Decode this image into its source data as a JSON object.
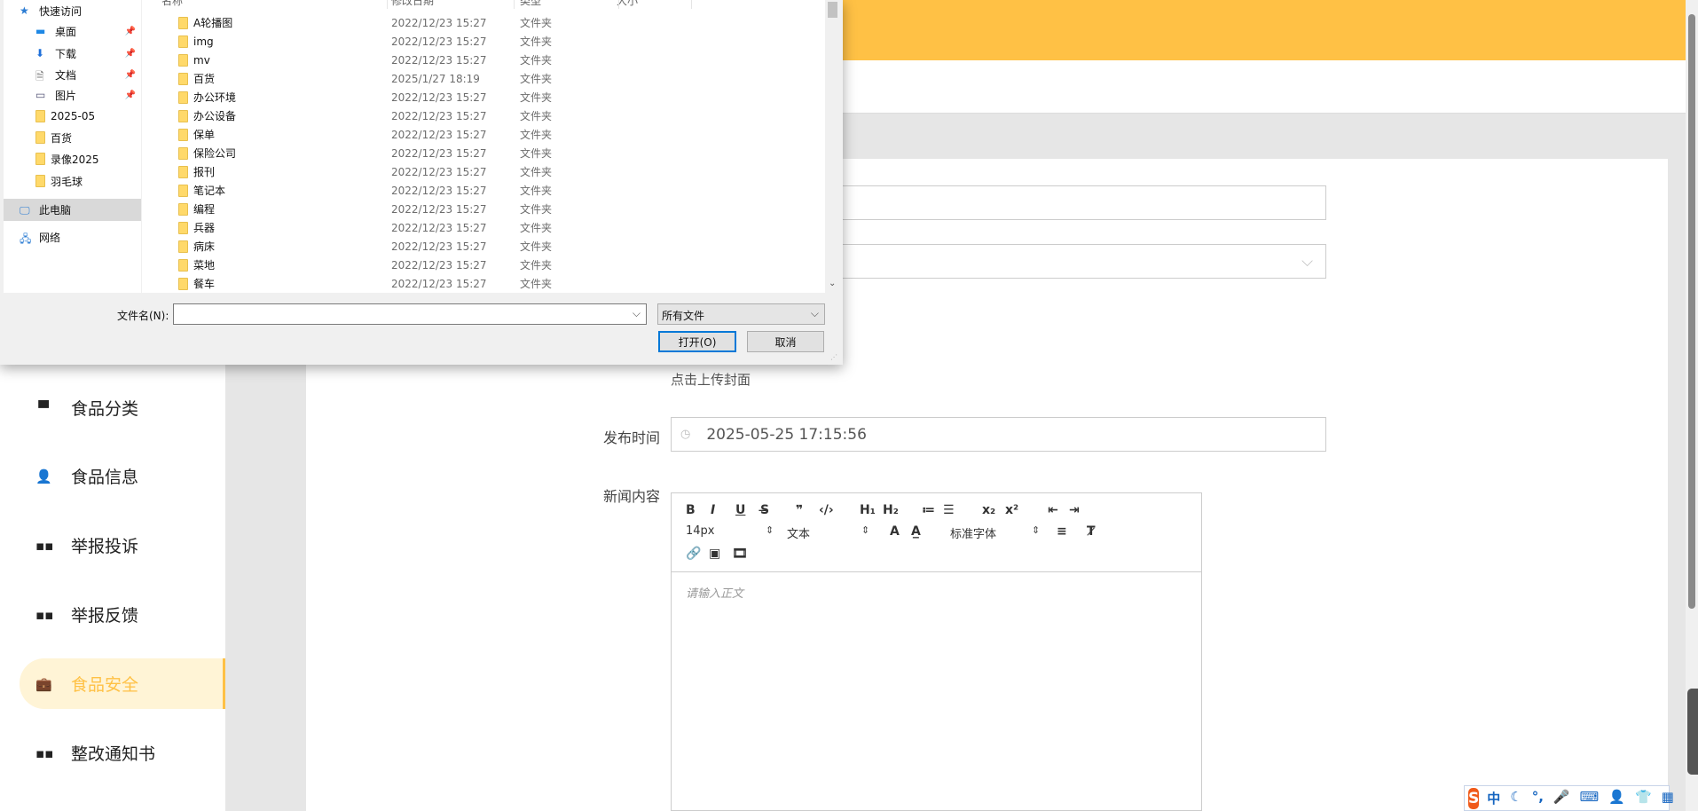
{
  "sidebar": {
    "items": [
      {
        "label": "食品分类",
        "icon": "shop-icon",
        "glyph": "▀"
      },
      {
        "label": "食品信息",
        "icon": "user-icon",
        "glyph": "👤"
      },
      {
        "label": "举报投诉",
        "icon": "grid-icon",
        "glyph": "▪▪"
      },
      {
        "label": "举报反馈",
        "icon": "grid-icon",
        "glyph": "▪▪"
      },
      {
        "label": "食品安全",
        "icon": "briefcase-icon",
        "glyph": "💼",
        "active": true
      },
      {
        "label": "整改通知书",
        "icon": "grid-icon",
        "glyph": "▪▪"
      }
    ]
  },
  "form": {
    "upload_cover": "点击上传封面",
    "publish_time_label": "发布时间",
    "publish_time_value": "2025-05-25 17:15:56",
    "content_label": "新闻内容",
    "content_placeholder": "请输入正文"
  },
  "editor": {
    "font_size": "14px",
    "header_select": "文本",
    "font_family": "标准字体",
    "buttons": [
      "bold",
      "italic",
      "underline",
      "strike",
      "blockquote",
      "code-block",
      "h1",
      "h2",
      "ordered-list",
      "bullet-list",
      "subscript",
      "superscript",
      "outdent",
      "indent",
      "font-color",
      "background",
      "align",
      "clean",
      "link",
      "image",
      "video"
    ]
  },
  "dialog": {
    "columns": [
      "名称",
      "修改日期",
      "类型",
      "大小"
    ],
    "nav": [
      {
        "label": "快速访问",
        "icon": "star-icon"
      },
      {
        "label": "桌面",
        "icon": "desktop-icon",
        "pinned": true
      },
      {
        "label": "下载",
        "icon": "download-icon",
        "pinned": true
      },
      {
        "label": "文档",
        "icon": "document-icon",
        "pinned": true
      },
      {
        "label": "图片",
        "icon": "picture-icon",
        "pinned": true
      },
      {
        "label": "2025-05",
        "icon": "folder-icon"
      },
      {
        "label": "百货",
        "icon": "folder-icon"
      },
      {
        "label": "录像2025",
        "icon": "folder-icon"
      },
      {
        "label": "羽毛球",
        "icon": "folder-icon"
      },
      {
        "label": "此电脑",
        "icon": "computer-icon",
        "selected": true
      },
      {
        "label": "网络",
        "icon": "network-icon"
      }
    ],
    "files": [
      {
        "name": "A轮播图",
        "date": "2022/12/23 15:27",
        "type": "文件夹"
      },
      {
        "name": "img",
        "date": "2022/12/23 15:27",
        "type": "文件夹"
      },
      {
        "name": "mv",
        "date": "2022/12/23 15:27",
        "type": "文件夹"
      },
      {
        "name": "百货",
        "date": "2025/1/27 18:19",
        "type": "文件夹"
      },
      {
        "name": "办公环境",
        "date": "2022/12/23 15:27",
        "type": "文件夹"
      },
      {
        "name": "办公设备",
        "date": "2022/12/23 15:27",
        "type": "文件夹"
      },
      {
        "name": "保单",
        "date": "2022/12/23 15:27",
        "type": "文件夹"
      },
      {
        "name": "保险公司",
        "date": "2022/12/23 15:27",
        "type": "文件夹"
      },
      {
        "name": "报刊",
        "date": "2022/12/23 15:27",
        "type": "文件夹"
      },
      {
        "name": "笔记本",
        "date": "2022/12/23 15:27",
        "type": "文件夹"
      },
      {
        "name": "编程",
        "date": "2022/12/23 15:27",
        "type": "文件夹"
      },
      {
        "name": "兵器",
        "date": "2022/12/23 15:27",
        "type": "文件夹"
      },
      {
        "name": "病床",
        "date": "2022/12/23 15:27",
        "type": "文件夹"
      },
      {
        "name": "菜地",
        "date": "2022/12/23 15:27",
        "type": "文件夹"
      },
      {
        "name": "餐车",
        "date": "2022/12/23 15:27",
        "type": "文件夹"
      }
    ],
    "filename_label": "文件名(N):",
    "filename_value": "",
    "filetype": "所有文件",
    "open_button": "打开(O)",
    "cancel_button": "取消"
  },
  "ime": {
    "items": [
      "中",
      "☾",
      "°,",
      "🎤",
      "⌨",
      "👤",
      "👕",
      "▦"
    ]
  },
  "colors": {
    "accent": "#ffc145",
    "active_bg": "#fff4d6"
  }
}
